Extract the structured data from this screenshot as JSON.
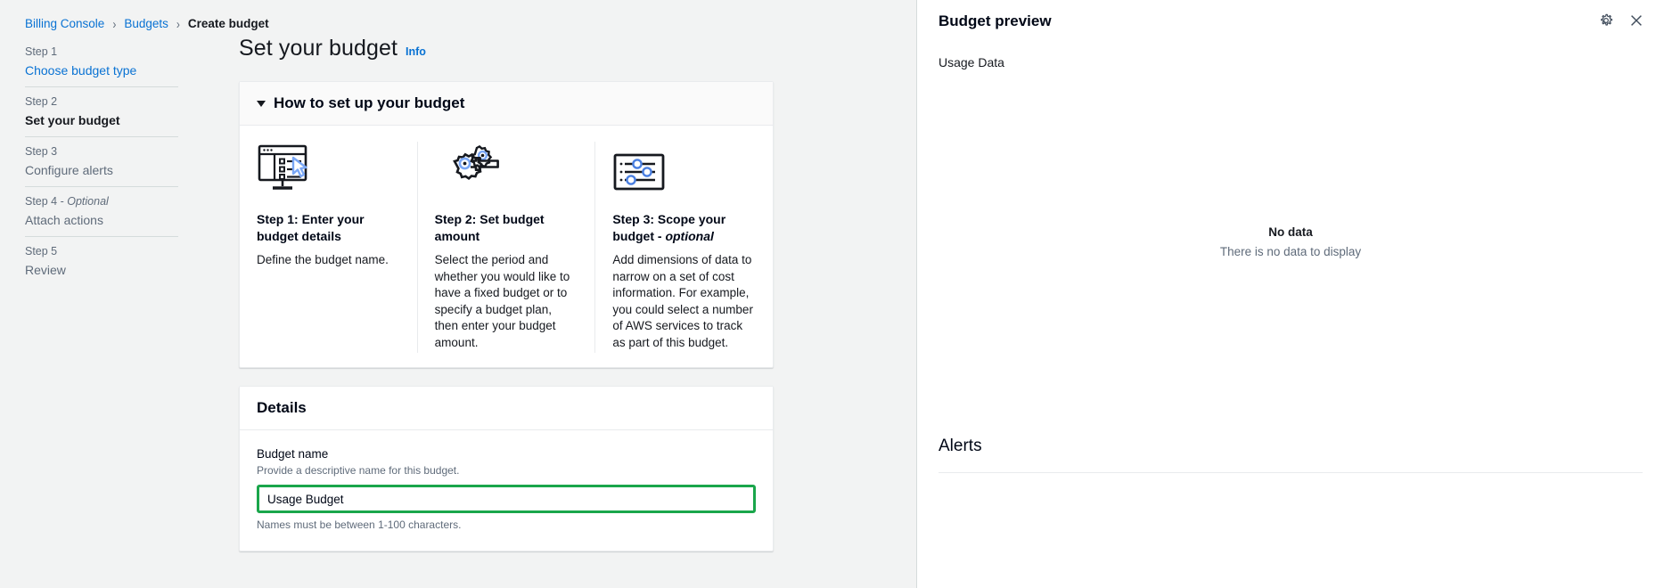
{
  "breadcrumb": {
    "items": [
      {
        "label": "Billing Console",
        "current": false
      },
      {
        "label": "Budgets",
        "current": false
      },
      {
        "label": "Create budget",
        "current": true
      }
    ],
    "separator": "›"
  },
  "wizard": {
    "steps": [
      {
        "number": "Step 1",
        "label": "Choose budget type",
        "state": "link",
        "optional": ""
      },
      {
        "number": "Step 2",
        "label": "Set your budget",
        "state": "active",
        "optional": ""
      },
      {
        "number": "Step 3",
        "label": "Configure alerts",
        "state": "muted",
        "optional": ""
      },
      {
        "number": "Step 4 - ",
        "label": "Attach actions",
        "state": "muted",
        "optional": "Optional"
      },
      {
        "number": "Step 5",
        "label": "Review",
        "state": "muted",
        "optional": ""
      }
    ]
  },
  "page": {
    "title": "Set your budget",
    "info_link": "Info"
  },
  "howto": {
    "header": "How to set up your budget",
    "cards": [
      {
        "icon": "monitor-checklist-cursor-icon",
        "title": "Step 1: Enter your budget details",
        "optional": "",
        "text": "Define the budget name."
      },
      {
        "icon": "gears-wrench-icon",
        "title": "Step 2: Set budget amount",
        "optional": "",
        "text": "Select the period and whether you would like to have a fixed budget or to specify a budget plan, then enter your budget amount."
      },
      {
        "icon": "sliders-panel-icon",
        "title": "Step 3: Scope your budget - ",
        "optional": "optional",
        "text": "Add dimensions of data to narrow on a set of cost information. For example, you could select a number of AWS services to track as part of this budget."
      }
    ]
  },
  "details": {
    "header": "Details",
    "budget_name": {
      "label": "Budget name",
      "description": "Provide a descriptive name for this budget.",
      "value": "Usage Budget",
      "placeholder": "",
      "hint": "Names must be between 1-100 characters.",
      "highlight_color": "#1aa64b"
    }
  },
  "preview": {
    "title": "Budget preview",
    "section_label": "Usage Data",
    "gear_icon": "gear-icon",
    "close_icon": "close-icon",
    "empty_state": {
      "title": "No data",
      "subtitle": "There is no data to display"
    },
    "alerts_header": "Alerts"
  },
  "colors": {
    "link": "#0972d3",
    "accent_green": "#1aa64b",
    "text": "#16191f",
    "muted": "#5f6b7a"
  }
}
